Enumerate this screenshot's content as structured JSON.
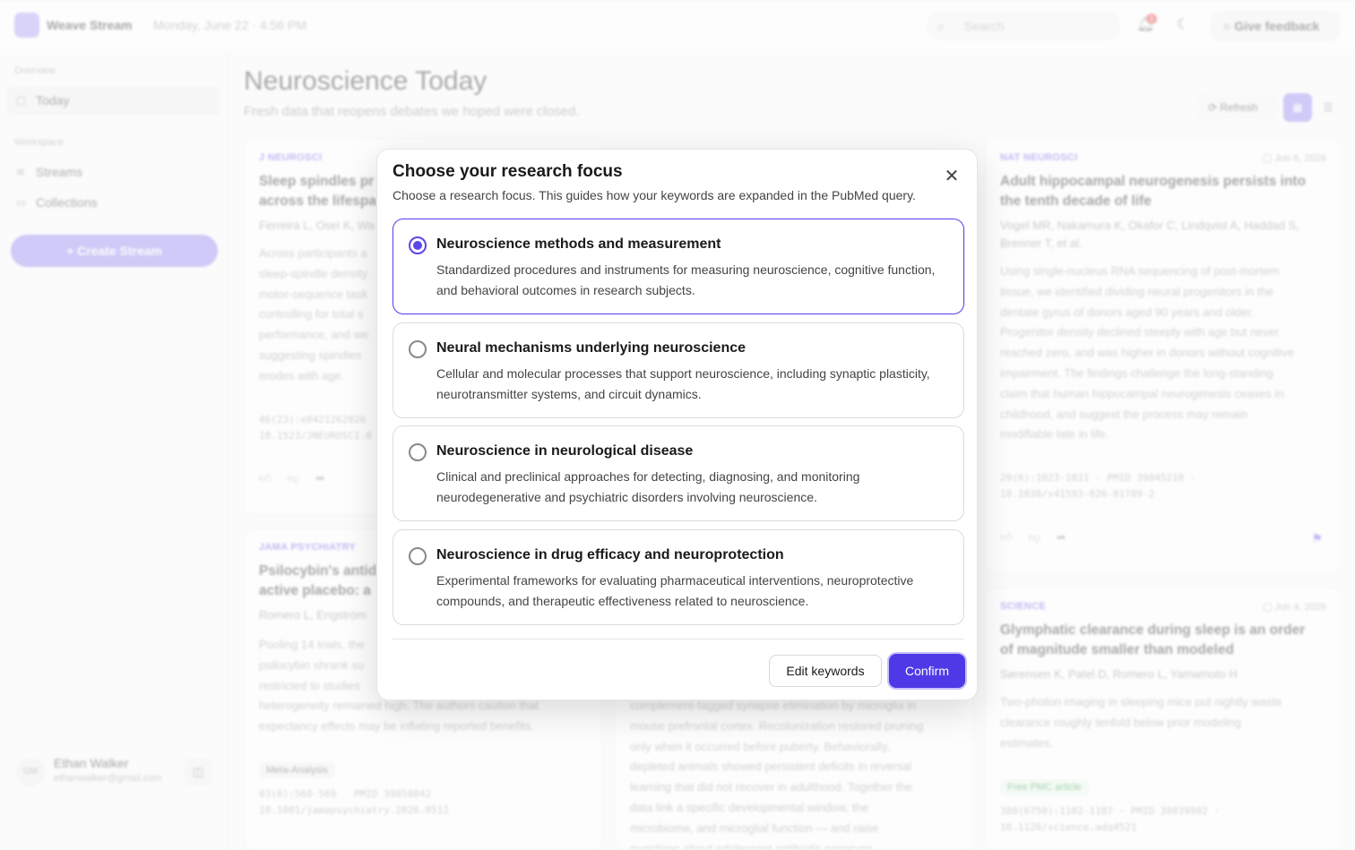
{
  "header": {
    "app_name": "Weave Stream",
    "date": "Monday, June 22 · 4:56 PM",
    "search_placeholder": "Search",
    "notification_count": "1",
    "feedback_label": "Give feedback"
  },
  "sidebar": {
    "section_overview": "Overview",
    "today_label": "Today",
    "section_workspace": "Workspace",
    "streams_label": "Streams",
    "collections_label": "Collections",
    "create_label": "+ Create Stream",
    "user": {
      "initials": "GM",
      "name": "Ethan Walker",
      "email": "ethanwalker@gmail.com"
    }
  },
  "main": {
    "title": "Neuroscience Today",
    "subtitle": "Fresh data that reopens debates we hoped were closed.",
    "refresh_label": "Refresh"
  },
  "cards": {
    "c1": {
      "journal": "J NEUROSCI",
      "title": "Sleep spindles pr\nacross the lifespa",
      "authors": "Ferreira L, Osei K, Wa",
      "abstract": "Across participants a\nsleep-spindle density\nmotor-sequence task\ncontrolling for total s\nperformance, and we\nsuggesting spindles\nerodes with age.",
      "cite": "46(23):e0421262026\n10.1523/JNEUROSCI.0"
    },
    "c2": {
      "journal": "JAMA PSYCHIATRY",
      "title": "Psilocybin's antid\nactive placebo: a",
      "authors": "Romero L, Engström",
      "abstract": "Pooling 14 trials, the\npsilocybin shrank su\nrestricted to studies\nheterogeneity remained high. The authors caution that\nexpectancy effects may be inflating reported benefits.",
      "tag": "Meta-Analysis",
      "cite": "83(6):560-569   PMID 39858042\n10.1001/jamapsychiatry.2026.0512"
    },
    "c3": {
      "abstract": "complement-tagged synapse elimination by microglia in\nmouse prefrontal cortex. Recolonization restored pruning\nonly when it occurred before puberty. Behaviorally,\ndepleted animals showed persistent deficits in reversal\nlearning that did not recover in adulthood. Together the\ndata link a specific developmental window, the\nmicrobiome, and microglial function — and raise\nquestions about adolescent antibiotic exposure."
    },
    "c4": {
      "journal": "NAT NEUROSCI",
      "date": "Jun 6, 2026",
      "title": "Adult hippocampal neurogenesis persists into\nthe tenth decade of life",
      "authors": "Vogel MR, Nakamura K, Okafor C, Lindqvist A, Haddad S,\nBrenner T, et al.",
      "abstract": "Using single-nucleus RNA sequencing of post-mortem\ntissue, we identified dividing neural progenitors in the\ndentate gyrus of donors aged 90 years and older.\nProgenitor density declined steeply with age but never\nreached zero, and was higher in donors without cognitive\nimpairment. The findings challenge the long-standing\nclaim that human hippocampal neurogenesis ceases in\nchildhood, and suggest the process may remain\nmodifiable late in life.",
      "cite": "29(6):1023-1031 · PMID 39845210 ·\n10.1038/s41593-026-01789-2"
    },
    "c5": {
      "journal": "SCIENCE",
      "date": "Jun 4, 2026",
      "title": "Glymphatic clearance during sleep is an order\nof magnitude smaller than modeled",
      "authors": "Sørensen K, Patel D, Romero L, Yamamoto H",
      "abstract": "Two-photon imaging in sleeping mice put nightly waste\nclearance roughly tenfold below prior modeling\nestimates.",
      "tag": "Free PMC article",
      "cite": "388(6750):1102-1107 · PMID 39839902 ·\n10.1126/science.adq4521"
    }
  },
  "modal": {
    "title": "Choose your research focus",
    "description": "Choose a research focus. This guides how your keywords are expanded in the PubMed query.",
    "options": [
      {
        "title": "Neuroscience methods and measurement",
        "description": "Standardized procedures and instruments for measuring neuroscience, cognitive function, and behavioral outcomes in research subjects.",
        "selected": true
      },
      {
        "title": "Neural mechanisms underlying neuroscience",
        "description": "Cellular and molecular processes that support neuroscience, including synaptic plasticity, neurotransmitter systems, and circuit dynamics.",
        "selected": false
      },
      {
        "title": "Neuroscience in neurological disease",
        "description": "Clinical and preclinical approaches for detecting, diagnosing, and monitoring neurodegenerative and psychiatric disorders involving neuroscience.",
        "selected": false
      },
      {
        "title": "Neuroscience in drug efficacy and neuroprotection",
        "description": "Experimental frameworks for evaluating pharmaceutical interventions, neuroprotective compounds, and therapeutic effectiveness related to neuroscience.",
        "selected": false
      }
    ],
    "edit_label": "Edit keywords",
    "confirm_label": "Confirm"
  },
  "colors": {
    "accent": "#4f39e6",
    "accent_light": "#8f83f0"
  }
}
